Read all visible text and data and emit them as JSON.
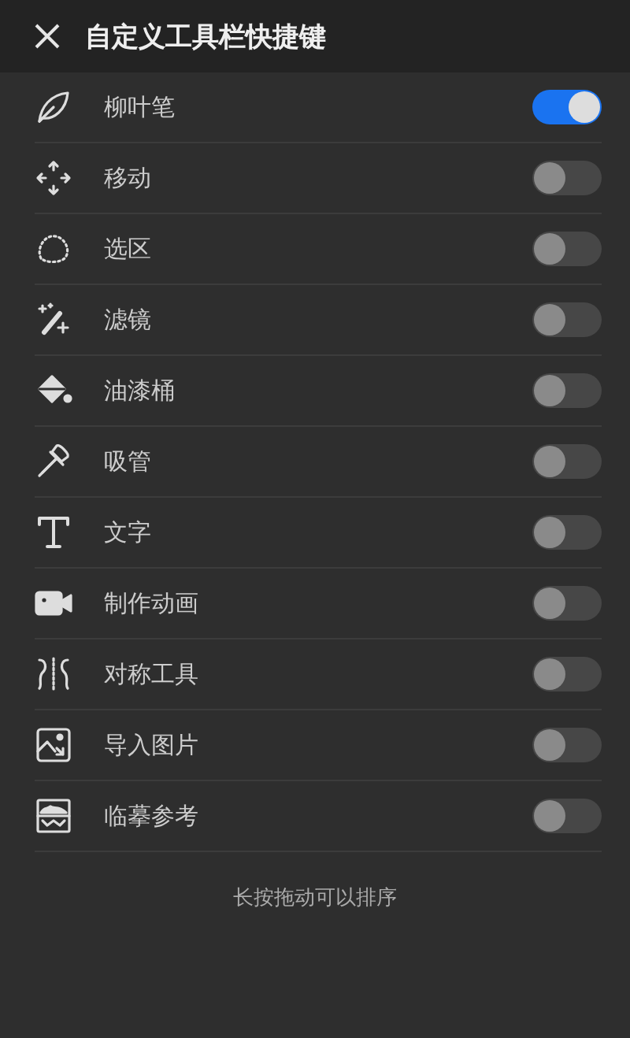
{
  "header": {
    "title": "自定义工具栏快捷键"
  },
  "tools": [
    {
      "kind": "leaf",
      "label": "柳叶笔",
      "on": true
    },
    {
      "kind": "move",
      "label": "移动",
      "on": false
    },
    {
      "kind": "lasso",
      "label": "选区",
      "on": false
    },
    {
      "kind": "wand",
      "label": "滤镜",
      "on": false
    },
    {
      "kind": "bucket",
      "label": "油漆桶",
      "on": false
    },
    {
      "kind": "dropper",
      "label": "吸管",
      "on": false
    },
    {
      "kind": "text",
      "label": "文字",
      "on": false
    },
    {
      "kind": "camera",
      "label": "制作动画",
      "on": false
    },
    {
      "kind": "symmetry",
      "label": "对称工具",
      "on": false
    },
    {
      "kind": "image",
      "label": "导入图片",
      "on": false
    },
    {
      "kind": "reference",
      "label": "临摹参考",
      "on": false
    }
  ],
  "hint": "长按拖动可以排序"
}
